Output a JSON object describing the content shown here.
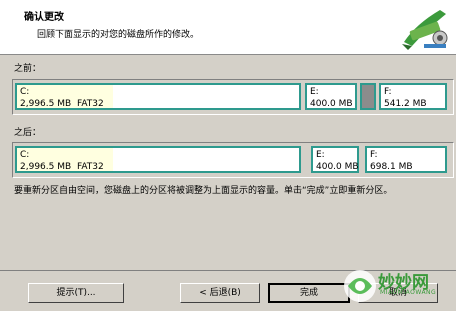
{
  "header": {
    "title": "确认更改",
    "subtitle": "回顾下面显示的对您的磁盘所作的修改。",
    "logo_icon": "wrench-tools-icon"
  },
  "before": {
    "label": "之前：",
    "partitions": [
      {
        "name": "C:",
        "size": "2,996.5 MB",
        "fs": "FAT32"
      },
      {
        "name": "E:",
        "size": "400.0 MB"
      },
      {
        "name": "F:",
        "size": "541.2 MB"
      }
    ]
  },
  "after": {
    "label": "之后：",
    "partitions": [
      {
        "name": "C:",
        "size": "2,996.5 MB",
        "fs": "FAT32"
      },
      {
        "name": "E:",
        "size": "400.0 MB"
      },
      {
        "name": "F:",
        "size": "698.1 MB"
      }
    ]
  },
  "description": "要重新分区自由空间，您磁盘上的分区将被调整为上面显示的容量。单击“完成”立即重新分区。",
  "buttons": {
    "hint": "提示(T)...",
    "back": "< 后退(B)",
    "finish": "完成",
    "cancel": "取消"
  },
  "watermark": {
    "text": "妙妙网",
    "url": "MIAOMIAOWANG"
  },
  "colors": {
    "partition_border": "#2e9a8e",
    "used_fill": "#ffffe0",
    "unallocated": "#8c8c8c"
  }
}
